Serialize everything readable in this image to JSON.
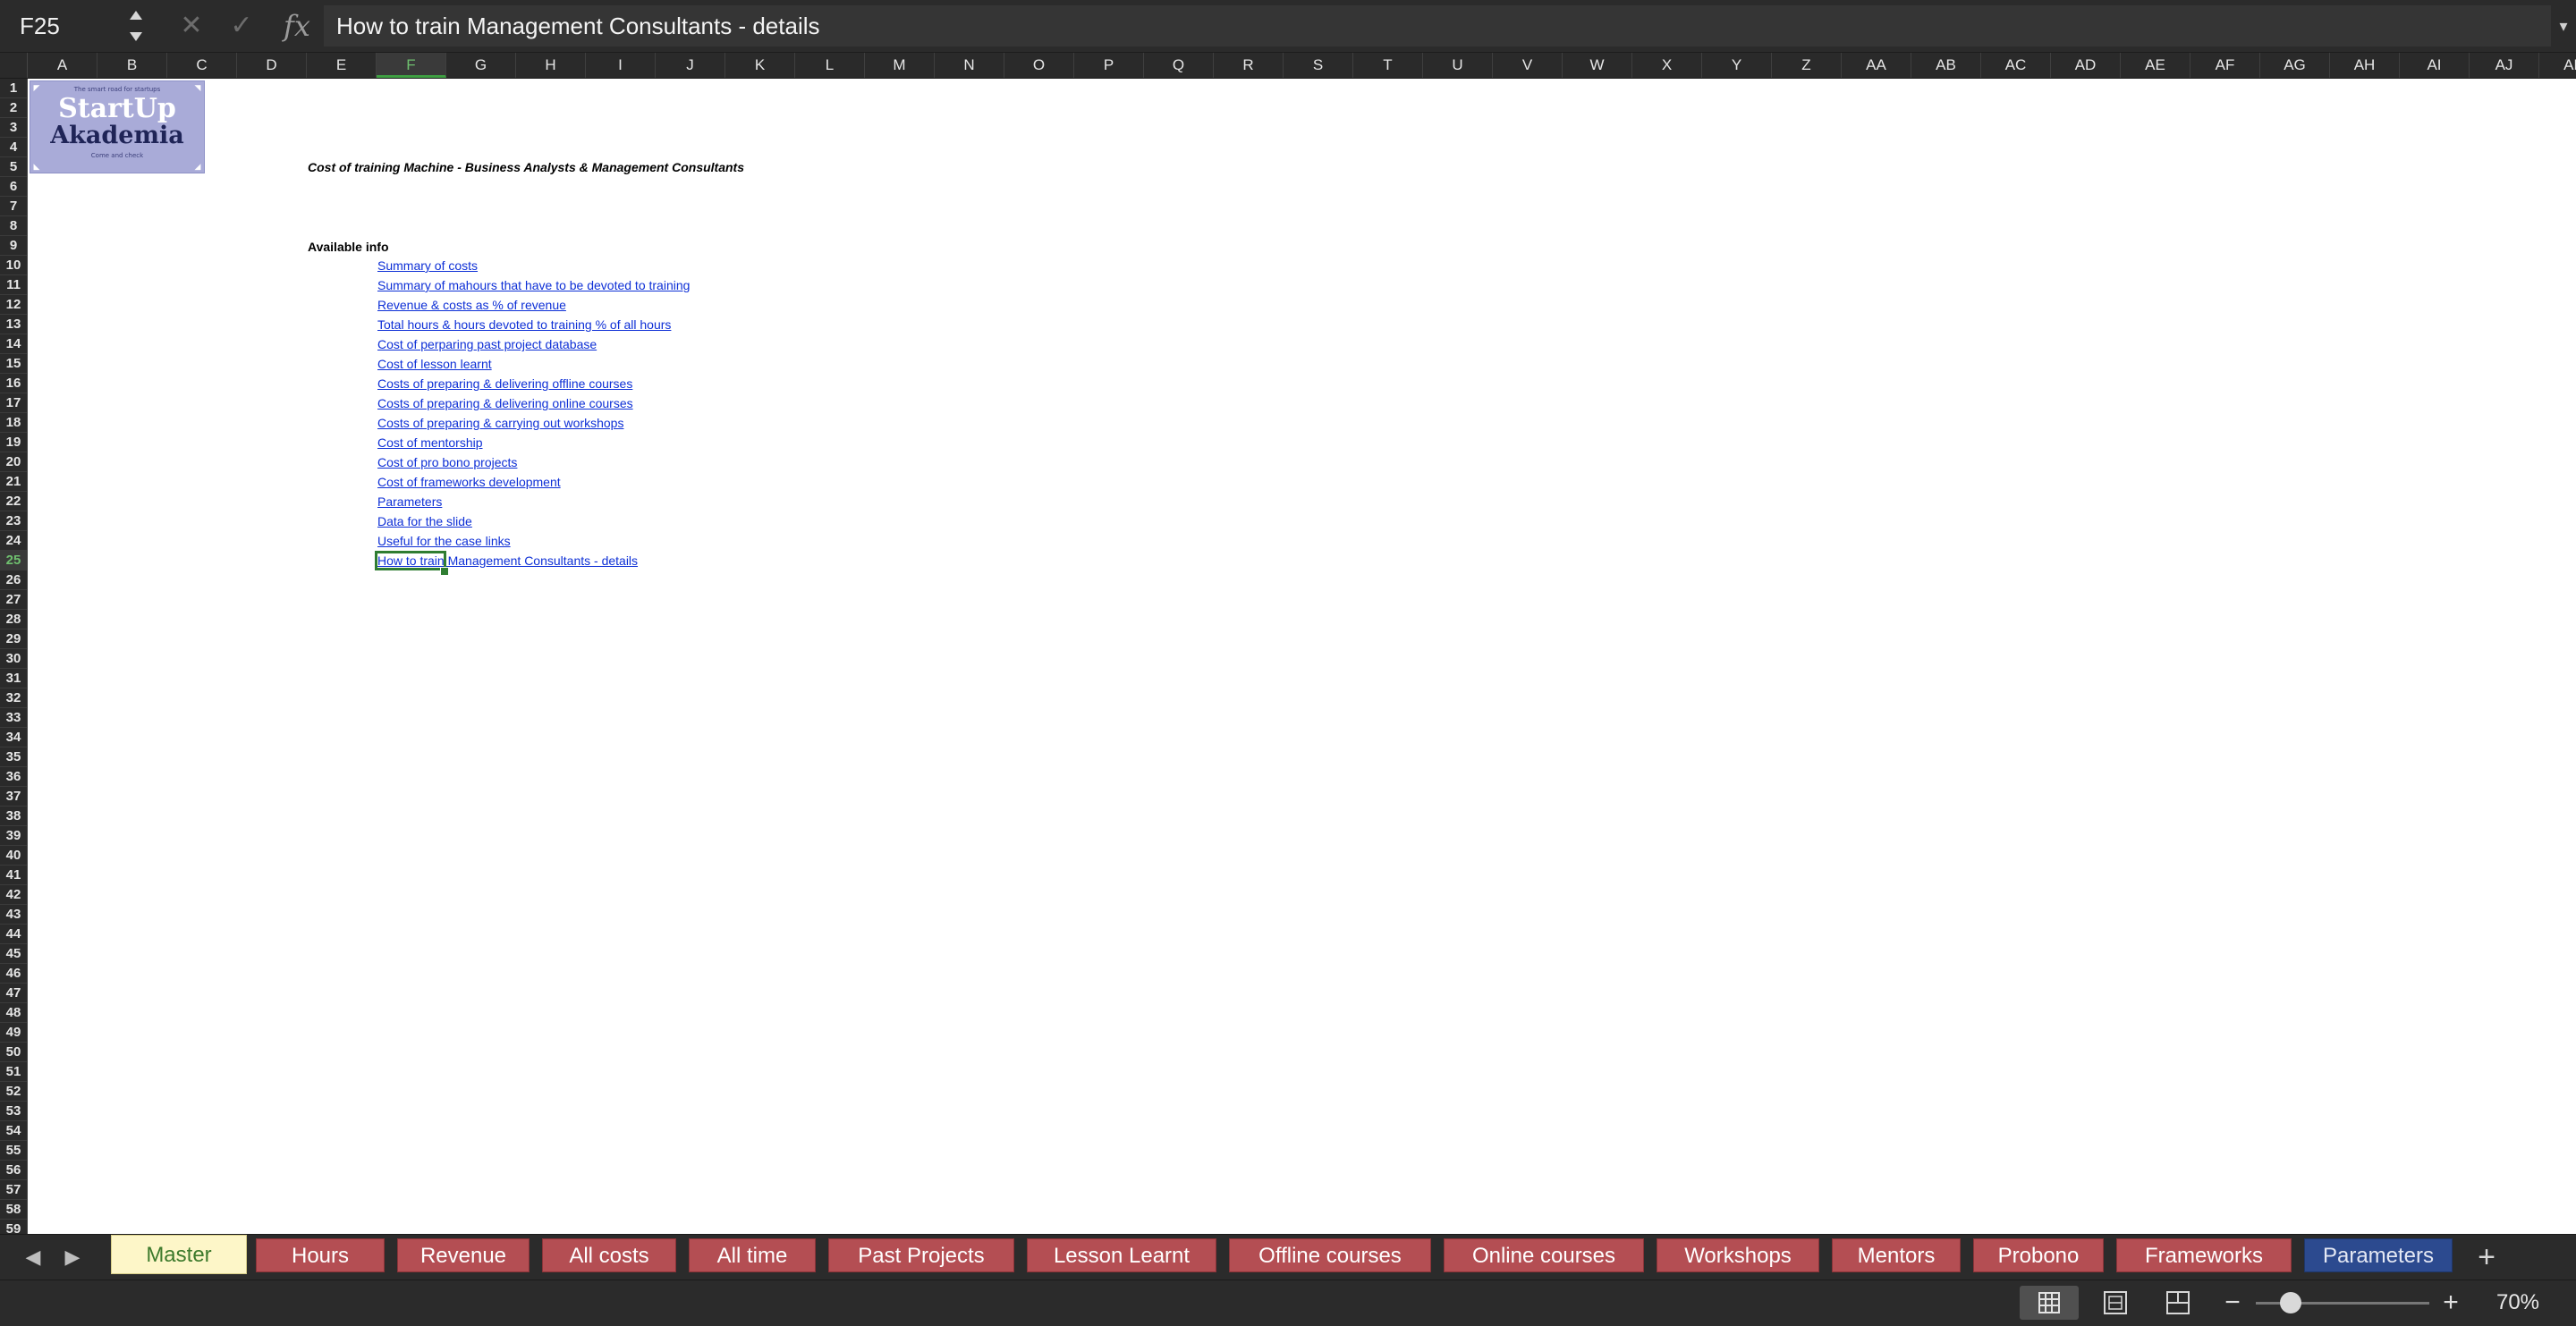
{
  "formula_bar": {
    "name_box": "F25",
    "stepper_icon": "▲▼",
    "cancel_icon": "✕",
    "confirm_icon": "✓",
    "fx_label": "fx",
    "content": "How to train Management Consultants - details",
    "expand_icon": "▾"
  },
  "columns": [
    "A",
    "B",
    "C",
    "D",
    "E",
    "F",
    "G",
    "H",
    "I",
    "J",
    "K",
    "L",
    "M",
    "N",
    "O",
    "P",
    "Q",
    "R",
    "S",
    "T",
    "U",
    "V",
    "W",
    "X",
    "Y",
    "Z",
    "AA",
    "AB",
    "AC",
    "AD",
    "AE",
    "AF",
    "AG",
    "AH",
    "AI",
    "AJ",
    "AK"
  ],
  "active_column": "F",
  "rows": {
    "first": 1,
    "last": 59,
    "active": 25
  },
  "logo": {
    "tagline": "The smart road for startups",
    "word1": "StartUp",
    "word2": "Akademia",
    "footer": "Come and check"
  },
  "sheet": {
    "title": "Cost of training Machine - Business Analysts & Management Consultants",
    "section_label": "Available info",
    "links": [
      "Summary of costs",
      "Summary of mahours that have to be devoted to training",
      "Revenue & costs as % of revenue",
      "Total hours & hours devoted to training % of all hours",
      "Cost of perparing past project database",
      "Cost of lesson learnt",
      "Costs of preparing & delivering offline courses",
      "Costs of preparing & delivering online courses",
      "Costs of preparing & carrying out workshops",
      "Cost of mentorship",
      "Cost of pro bono projects",
      "Cost of frameworks development",
      "Parameters",
      "Data for the slide",
      "Useful for the case links",
      "How to train Management Consultants - details"
    ]
  },
  "tabs": {
    "prev_icon": "◀",
    "next_icon": "▶",
    "items": [
      "Master",
      "Hours",
      "Revenue",
      "All costs",
      "All time",
      "Past Projects",
      "Lesson Learnt",
      "Offline courses",
      "Online courses",
      "Workshops",
      "Mentors",
      "Probono",
      "Frameworks",
      "Parameters"
    ],
    "active": "Master",
    "add_icon": "+"
  },
  "status_bar": {
    "zoom_out_icon": "−",
    "zoom_in_icon": "+",
    "zoom_level": "70%",
    "zoom_fraction": 0.2
  },
  "colors": {
    "tab_default": "#b44e53",
    "tab_active": "#fdf6c8",
    "tab_parameters": "#2c4a8f",
    "link": "#0d2fd6",
    "selection": "#2f7d32",
    "chrome_dark": "#2b2b2b"
  }
}
